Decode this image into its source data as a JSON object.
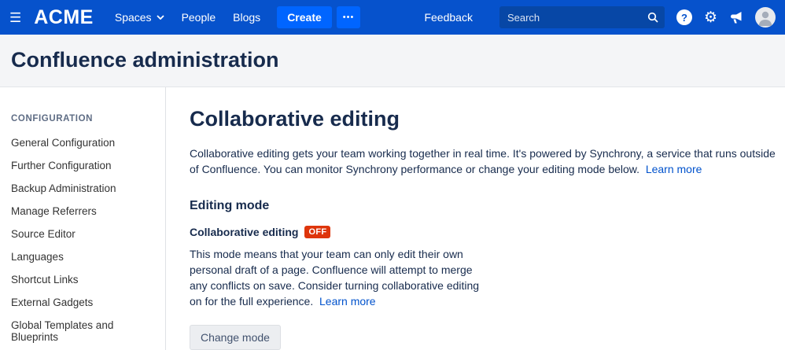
{
  "colors": {
    "nav_bg": "#0652CC",
    "nav_accent": "#0065FF",
    "search_bg": "#0747A6",
    "header_bg": "#F4F5F7",
    "heading_color": "#172B4D",
    "link_color": "#0052CC",
    "badge_bg": "#DE350B"
  },
  "nav": {
    "logo": "ACME",
    "items": [
      {
        "label": "Spaces"
      },
      {
        "label": "People"
      },
      {
        "label": "Blogs"
      }
    ],
    "create_label": "Create",
    "more_label": "•••",
    "feedback_label": "Feedback",
    "search_placeholder": "Search"
  },
  "header": {
    "title": "Confluence administration"
  },
  "sidebar": {
    "section_title": "CONFIGURATION",
    "items": [
      "General Configuration",
      "Further Configuration",
      "Backup Administration",
      "Manage Referrers",
      "Source Editor",
      "Languages",
      "Shortcut Links",
      "External Gadgets",
      "Global Templates and Blueprints"
    ]
  },
  "main": {
    "title": "Collaborative editing",
    "intro": "Collaborative editing gets your team working together in real time. It's powered by Synchrony, a service that runs outside of Confluence. You can monitor Synchrony performance or change your editing mode below.",
    "intro_link": "Learn more",
    "section_title": "Editing mode",
    "mode_label": "Collaborative editing",
    "mode_badge": "OFF",
    "mode_description": "This mode means that your team can only edit their own personal draft of a page. Confluence will attempt to merge any conflicts on save. Consider turning collaborative editing on for the full experience.",
    "mode_link": "Learn more",
    "change_button": "Change mode"
  }
}
